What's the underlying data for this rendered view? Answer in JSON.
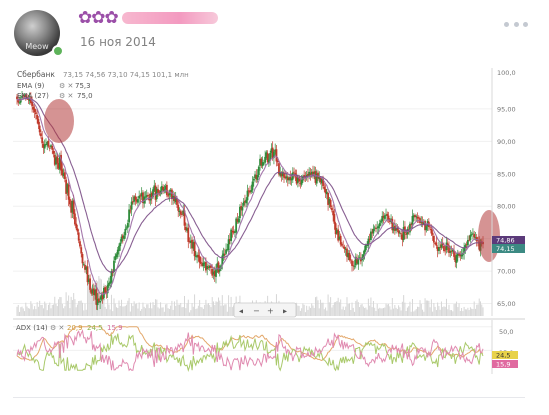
{
  "post": {
    "author_stars": "✿✿✿",
    "date": "16 ноя 2014",
    "avatar_label": "Meow",
    "more_icon": "more-dots-icon"
  },
  "chart": {
    "instrument_label": "Сбербанк",
    "ohlc_readout": "73,15  74,56  73,10  74,15  101,1 млн",
    "ema9_label": "EMA (9)",
    "ema9_value": "75,3",
    "ema27_label": "EMA (27)",
    "ema27_value": "75,0",
    "price_ticks": [
      "95,00",
      "90,00",
      "85,00",
      "80,00",
      "75,00",
      "70,00",
      "65,00"
    ],
    "top_tick_partial": "100,0",
    "last_price_tags": [
      "74,86",
      "74,15"
    ],
    "adx_label": "ADX (14)",
    "adx_values": [
      "20,9",
      "24,5",
      "15,9"
    ],
    "adx_ticks": [
      "50,0",
      "25,0"
    ],
    "adx_tags": [
      "24,5",
      "15,9"
    ],
    "zoom_controls": [
      "◂",
      "−",
      "+",
      "▸"
    ],
    "colors": {
      "up": "#2e8b3a",
      "down": "#c0392b",
      "ema9": "#9b6aa3",
      "ema27": "#7b4e86",
      "adx": "#e3a86b",
      "di_plus": "#a9c96a",
      "di_minus": "#e08ab0",
      "highlight": "#b23a3a"
    }
  },
  "chart_data": {
    "type": "candlestick",
    "title": "Сбербанк",
    "ylim": [
      64,
      101
    ],
    "price_ticks": [
      95,
      90,
      85,
      80,
      75,
      70,
      65
    ],
    "close": [
      96.5,
      96,
      96,
      96.6,
      97,
      97,
      97.2,
      96.8,
      96.6,
      96.4,
      96.7,
      95.9,
      95.4,
      94.9,
      94.5,
      94.2,
      93.4,
      92.6,
      91.4,
      90.8,
      89.7,
      89,
      89.5,
      89.6,
      89.9,
      89.2,
      88.9,
      89.4,
      88.7,
      88.1,
      86.4,
      87.5,
      86.6,
      85.8,
      87.8,
      85.5,
      84.8,
      85.1,
      84.2,
      81.9,
      83.4,
      81,
      80.3,
      79,
      80.8,
      78.8,
      77.2,
      76.6,
      76.1,
      74.7,
      73.8,
      72.7,
      71.2,
      71.1,
      70.2,
      70.6,
      68.3,
      68.7,
      67.1,
      66.5,
      67.2,
      66.3,
      67.1,
      64.8,
      65.7,
      65.3,
      65.4,
      66.3,
      65.7,
      67.4,
      66.7,
      66.6,
      67.9,
      68.2,
      68.4,
      70,
      69.7,
      71.6,
      72.3,
      72.6,
      73.3,
      73.9,
      74.4,
      75.3,
      75.1,
      75.5,
      76.5,
      76.7,
      77.4,
      79.5,
      79.3,
      80.7,
      80.6,
      81.5,
      81,
      80.7,
      81.1,
      81.6,
      81.5,
      82.1,
      80.5,
      81.5,
      81.5,
      81.7,
      81.5,
      80.9,
      81.9,
      81.2,
      82.6,
      83.2,
      81,
      82.7,
      82.1,
      81.8,
      82.4,
      83.1,
      82.4,
      82.6,
      83.1,
      81.7,
      81.5,
      82,
      82.5,
      81.1,
      81.6,
      80.8,
      81.3,
      80.2,
      79.3,
      79.3,
      78.7,
      78.7,
      79.3,
      77,
      76.3,
      76.6,
      74.5,
      74.5,
      74.7,
      73.5,
      74.5,
      72.3,
      72.3,
      72.5,
      72.1,
      71.3,
      71.1,
      70.8,
      71.3,
      71.3,
      70.1,
      70.8,
      70.5,
      70.8,
      70.5,
      69.3,
      69.9,
      69.2,
      70.4,
      71.2,
      69.8,
      70.5,
      70.9,
      72.4,
      72.7,
      72.5,
      73.3,
      73.4,
      74.9,
      74.7,
      76.4,
      76,
      75.9,
      76.1,
      78.1,
      77.6,
      78.1,
      79.9,
      79.5,
      79.9,
      80.7,
      80.6,
      81,
      82.4,
      82.3,
      82.1,
      82.5,
      83.8,
      84.2,
      84.9,
      84.2,
      84.8,
      86.1,
      87.3,
      86.3,
      86.8,
      86.7,
      87.6,
      88.3,
      86.8,
      87.2,
      88.2,
      88.9,
      87.4,
      88.4,
      88.7,
      86.9,
      86.8,
      84.9,
      85.2,
      84.6,
      85.3,
      84.4,
      84.3,
      84.6,
      84,
      84.4,
      84,
      84.3,
      85.2,
      85.2,
      84.6,
      83.5,
      84.4,
      83.8,
      83.5,
      84.1,
      84.6,
      84.5,
      84.4,
      84.8,
      84.7,
      85.3,
      84.8,
      85.3,
      84.8,
      85.3,
      83.6,
      85,
      84.3,
      84.5,
      83.7,
      84.2,
      83.1,
      82.6,
      82,
      82.2,
      80.2,
      81.1,
      79.9,
      79.4,
      78.6,
      77.3,
      75.7,
      76.3,
      74.7,
      75.3,
      74.1,
      73.9,
      73.7,
      73.4,
      73.4,
      72.2,
      72.8,
      71.7,
      71.7,
      70.8,
      70.8,
      70.8,
      72.2,
      71.2,
      71.9,
      72.1,
      71.5,
      72.1,
      72.6,
      73.3,
      74,
      74,
      75,
      74.9,
      76.1,
      75.8,
      76.5,
      76.7,
      76.5,
      76.7,
      76.9,
      77.4,
      77.8,
      78.5,
      78.2,
      78.6,
      78.7,
      78.5,
      77.9,
      77.6,
      78.1,
      76.3,
      76.8,
      76.2,
      76.6,
      76.3,
      75.8,
      75.9,
      75.8,
      74.8,
      76.8,
      75.8,
      75.6,
      76.5,
      76.1,
      77.3,
      77.1,
      78.5,
      78.6,
      78.3,
      78.5,
      78.1,
      78.1,
      77.4,
      77.6,
      77.3,
      77.5,
      76.3,
      76.9,
      77.7,
      76.8,
      76.7,
      75.8,
      75.6,
      74.4,
      74.3,
      73.9,
      73.1,
      73.7,
      73.6,
      74.1,
      74,
      73.1,
      73.1,
      74.4,
      73.8,
      72.8,
      73.1,
      73.1,
      73.3,
      72.2,
      71.4,
      72.5,
      72.7,
      72.5,
      72.3,
      72.6,
      72.8,
      73.6,
      74,
      74.1,
      74.8,
      74.8,
      75.6,
      75.7,
      75.9,
      75.2,
      75.2,
      74.6,
      74.7,
      73.3,
      74.7,
      74.4,
      74.15
    ],
    "ema9_last": 75.3,
    "ema27_last": 75.0,
    "adx_last": 20.9,
    "di_plus_last": 24.5,
    "di_minus_last": 15.9,
    "adx_ylim": [
      0,
      55
    ],
    "adx_ticks": [
      50,
      25
    ]
  }
}
